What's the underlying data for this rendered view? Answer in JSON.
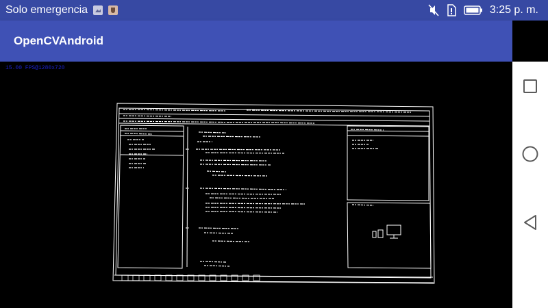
{
  "status_bar": {
    "carrier_text": "Solo emergencia",
    "time": "3:25 p. m.",
    "icons": [
      "gallery-notification-icon",
      "shield-notification-icon",
      "mute-icon",
      "no-sim-icon",
      "battery-icon"
    ]
  },
  "app_bar": {
    "title": "OpenCVAndroid"
  },
  "camera": {
    "fps_text": "15.00 FPS@1280x720",
    "scene": "canny-edge-detected-monitor"
  },
  "nav_bar": {
    "icons": [
      "recent-apps-icon",
      "home-icon",
      "back-icon"
    ]
  },
  "colors": {
    "status_bar": "#3749a3",
    "app_bar": "#3f51b5",
    "fps_text": "#1b22c8",
    "edges": "#ffffff"
  }
}
